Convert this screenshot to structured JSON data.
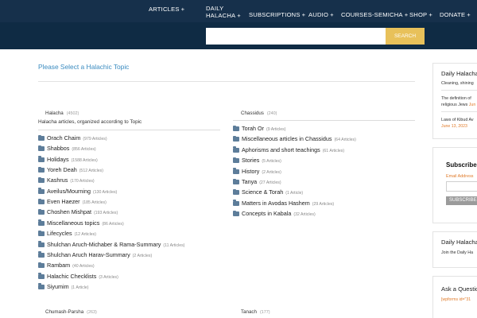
{
  "nav": {
    "items": [
      {
        "label": "ARTICLES",
        "plus": "+"
      },
      {
        "label1": "DAILY",
        "label2": "HALACHA",
        "plus": "+"
      },
      {
        "label": "SUBSCRIPTIONS",
        "plus": "+"
      },
      {
        "label": "AUDIO",
        "plus": "+"
      },
      {
        "label": "COURSES-SEMICHA",
        "plus": "+"
      },
      {
        "label": "SHOP",
        "plus": "+"
      },
      {
        "label": "DONATE",
        "plus": "+"
      }
    ]
  },
  "search": {
    "placeholder": "",
    "button": "SEARCH"
  },
  "main": {
    "title": "Please Select a Halachic Topic",
    "left": {
      "heading": "Halacha",
      "count": "(4502)",
      "description": "Halacha articles, organized according to Topic",
      "items": [
        {
          "label": "Orach Chaim",
          "count": "(979 Articles)"
        },
        {
          "label": "Shabbos",
          "count": "(856 Articles)"
        },
        {
          "label": "Holidays",
          "count": "(1588 Articles)"
        },
        {
          "label": "Yoreh Deah",
          "count": "(512 Articles)"
        },
        {
          "label": "Kashrus",
          "count": "(170 Articles)"
        },
        {
          "label": "Aveilus/Mourning",
          "count": "(130 Articles)"
        },
        {
          "label": "Even Haezer",
          "count": "(185 Articles)"
        },
        {
          "label": "Choshen Mishpat",
          "count": "(193 Articles)"
        },
        {
          "label": "Miscellaneous topics",
          "count": "(86 Articles)"
        },
        {
          "label": "Lifecycles",
          "count": "(12 Articles)"
        },
        {
          "label": "Shulchan Aruch-Michaber & Rama-Summary",
          "count": "(11 Articles)"
        },
        {
          "label": "Shulchan Aruch Harav-Summary",
          "count": "(2 Articles)"
        },
        {
          "label": "Rambam",
          "count": "(40 Articles)"
        },
        {
          "label": "Halachic Checklists",
          "count": "(3 Articles)"
        },
        {
          "label": "Siyumim",
          "count": "(1 Article)"
        }
      ]
    },
    "right": {
      "heading": "Chassidus",
      "count": "(240)",
      "items": [
        {
          "label": "Torah Or",
          "count": "(9 Articles)"
        },
        {
          "label": "Miscellaneous articles in Chassidus",
          "count": "(64 Articles)"
        },
        {
          "label": "Aphorisms and short teachings",
          "count": "(61 Articles)"
        },
        {
          "label": "Stories",
          "count": "(5 Articles)"
        },
        {
          "label": "History",
          "count": "(2 Articles)"
        },
        {
          "label": "Tanya",
          "count": "(27 Articles)"
        },
        {
          "label": "Science & Torah",
          "count": "(1 Article)"
        },
        {
          "label": "Matters in Avodas Hashem",
          "count": "(29 Articles)"
        },
        {
          "label": "Concepts in Kabala",
          "count": "(32 Articles)"
        }
      ]
    },
    "bottom": {
      "left": {
        "heading": "Chumash-Parsha",
        "count": "(263)"
      },
      "right": {
        "heading": "Tanach",
        "count": "(177)"
      }
    }
  },
  "sidebar": {
    "daily": {
      "title": "Daily Halacha",
      "line1": "Cleaning, shining",
      "line2a": "The definition of",
      "line2b": "religious Jews",
      "line2c": "Jun",
      "line3": "Laws of Kibud Av",
      "date": "June 13, 2023"
    },
    "subscribe": {
      "title": "Subscribe",
      "label": "Email Address",
      "button": "SUBSCRIBE"
    },
    "daily2": {
      "title": "Daily Halacha",
      "text": "Join the Daily Ha"
    },
    "ask": {
      "title": "Ask a Question",
      "text": "[wpforms id=\"31"
    }
  }
}
